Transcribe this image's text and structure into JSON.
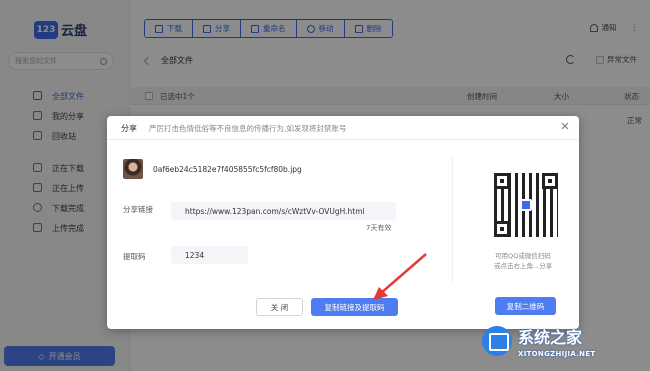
{
  "app": {
    "logo_mark": "123",
    "logo_text": "云盘"
  },
  "sidebar": {
    "search_placeholder": "搜索您的文件",
    "items": [
      {
        "label": "全部文件",
        "icon": "folder-icon",
        "active": true
      },
      {
        "label": "我的分享",
        "icon": "share-icon"
      },
      {
        "label": "回收站",
        "icon": "trash-icon"
      },
      {
        "label": "正在下载",
        "icon": "download-icon"
      },
      {
        "label": "正在上传",
        "icon": "upload-icon"
      },
      {
        "label": "下载完成",
        "icon": "check-circle-icon"
      },
      {
        "label": "上传完成",
        "icon": "file-check-icon"
      }
    ],
    "vip_button": "开通会员"
  },
  "toolbar": {
    "download": "下载",
    "share": "分享",
    "rename": "重命名",
    "move": "移动",
    "delete": "删除"
  },
  "header": {
    "notify": "通知",
    "path": "全部文件",
    "abnormal": "异常文件"
  },
  "table": {
    "selected": "已选中1个",
    "col_created": "创建时间",
    "col_size": "大小",
    "col_status": "状态",
    "row_status": "正常"
  },
  "dialog": {
    "title": "分享",
    "notice": "严厉打击色情低俗等不良信息的传播行为,如发现将封禁账号",
    "filename": "0af6eb24c5182e7f405855fc5fcf80b.jpg",
    "link_label": "分享链接",
    "link_value": "https://www.123pan.com/s/cWztVv-OVUgH.html",
    "validity": "7天有效",
    "code_label": "提取码",
    "code_value": "1234",
    "qr_caption_1": "可用QQ或微信扫码",
    "qr_caption_2": "或点击右上角...分享",
    "btn_close": "关 闭",
    "btn_copy": "复制链接及提取码",
    "btn_copy_qr": "复制二维码"
  },
  "watermark": {
    "title": "系统之家",
    "subtitle": "XITONGZHIJIA.NET"
  },
  "colors": {
    "accent": "#4f7cf0",
    "arrow": "#e53935"
  }
}
